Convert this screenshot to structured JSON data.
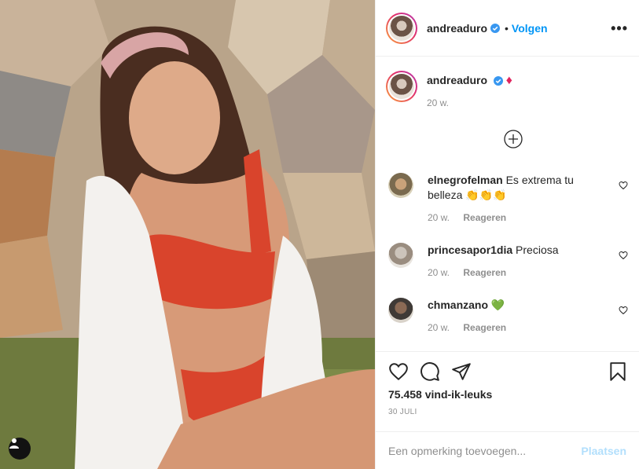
{
  "header": {
    "username": "andreaduro",
    "separator": "•",
    "follow_label": "Volgen",
    "more_label": "•••"
  },
  "caption": {
    "username": "andreaduro",
    "text": "♦",
    "time": "20 w."
  },
  "comments": [
    {
      "username": "elnegrofelman",
      "text": "Es extrema tu belleza 👏👏👏",
      "time": "20 w.",
      "reply_label": "Reageren"
    },
    {
      "username": "princesapor1dia",
      "text": "Preciosa",
      "time": "20 w.",
      "reply_label": "Reageren"
    },
    {
      "username": "chmanzano",
      "text": "💚",
      "time": "20 w.",
      "reply_label": "Reageren"
    }
  ],
  "actions": {
    "likes": "75.458 vind-ik-leuks",
    "date": "30 JULI"
  },
  "add_comment": {
    "placeholder": "Een opmerking toevoegen...",
    "post_label": "Plaatsen"
  },
  "colors": {
    "link_blue": "#0095f6",
    "verified_blue": "#3897f0",
    "muted": "#8e8e8e",
    "diamond_red": "#e0245e"
  },
  "icons": [
    "tag-user-icon",
    "verified-icon",
    "more-options-icon",
    "add-circle-icon",
    "heart-icon",
    "comment-icon",
    "share-icon",
    "bookmark-icon"
  ]
}
